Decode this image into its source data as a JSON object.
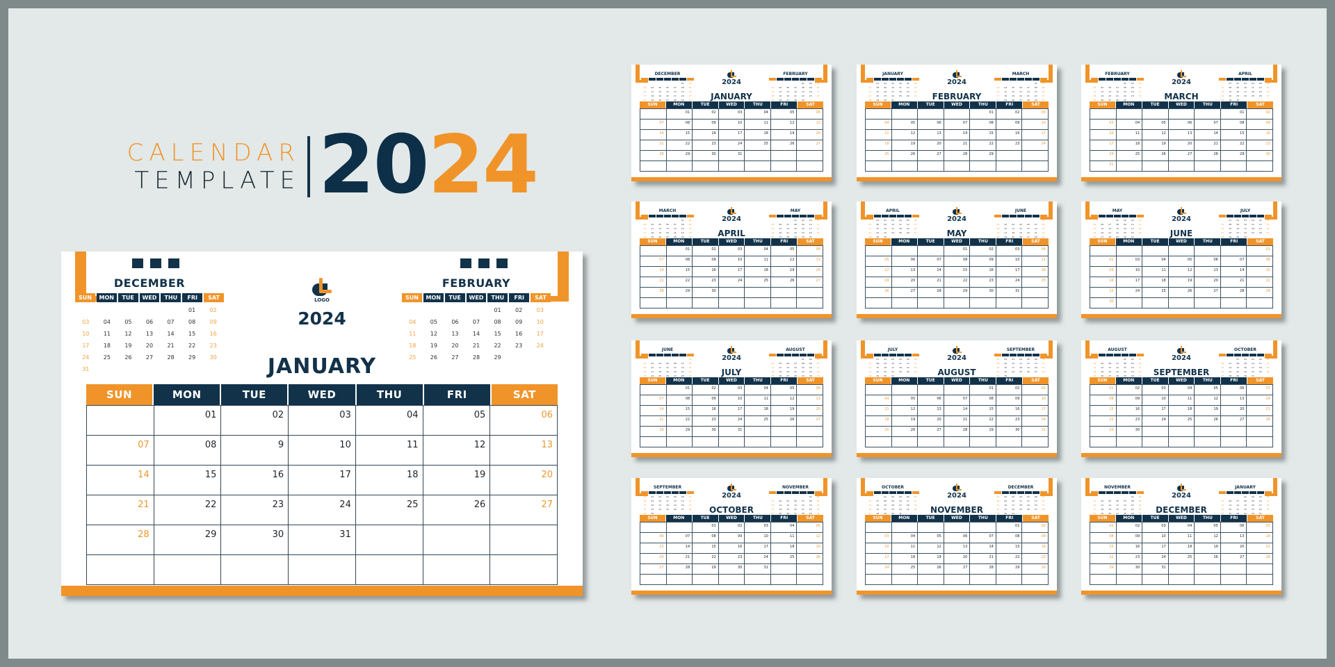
{
  "hero": {
    "line1": "CALENDAR",
    "line2": "TEMPLATE",
    "year_part1": "20",
    "year_part2": "24"
  },
  "colors": {
    "accent": "#f0942a",
    "navy": "#12324a",
    "background": "#e3e9e8",
    "frame": "#7f8a8a"
  },
  "weekdays": [
    "SUN",
    "MON",
    "TUE",
    "WED",
    "THU",
    "FRI",
    "SAT"
  ],
  "featured": {
    "month": "JANUARY",
    "year": "2024",
    "logo_text": "LOGO",
    "weeks": [
      [
        "",
        "01",
        "02",
        "03",
        "04",
        "05",
        "06"
      ],
      [
        "07",
        "08",
        "9",
        "10",
        "11",
        "12",
        "13"
      ],
      [
        "14",
        "15",
        "16",
        "17",
        "18",
        "19",
        "20"
      ],
      [
        "21",
        "22",
        "23",
        "24",
        "25",
        "26",
        "27"
      ],
      [
        "28",
        "29",
        "30",
        "31",
        "",
        "",
        ""
      ],
      [
        "",
        "",
        "",
        "",
        "",
        "",
        ""
      ]
    ],
    "prev_mini": {
      "title": "DECEMBER",
      "weeks": [
        [
          "",
          "",
          "",
          "",
          "",
          "01",
          "02"
        ],
        [
          "03",
          "04",
          "05",
          "06",
          "07",
          "08",
          "09"
        ],
        [
          "10",
          "11",
          "12",
          "13",
          "14",
          "15",
          "16"
        ],
        [
          "17",
          "18",
          "19",
          "20",
          "21",
          "22",
          "23"
        ],
        [
          "24",
          "25",
          "26",
          "27",
          "28",
          "29",
          "30"
        ],
        [
          "31",
          "",
          "",
          "",
          "",
          "",
          ""
        ]
      ]
    },
    "next_mini": {
      "title": "FEBRUARY",
      "weeks": [
        [
          "",
          "",
          "",
          "",
          "01",
          "02",
          "03"
        ],
        [
          "04",
          "05",
          "06",
          "07",
          "08",
          "09",
          "10"
        ],
        [
          "11",
          "12",
          "13",
          "14",
          "15",
          "16",
          "17"
        ],
        [
          "18",
          "19",
          "20",
          "21",
          "22",
          "23",
          "24"
        ],
        [
          "25",
          "26",
          "27",
          "28",
          "29",
          "",
          ""
        ]
      ]
    }
  },
  "thumbnails": [
    {
      "month": "JANUARY",
      "year": "2024",
      "start": 1,
      "days": 31,
      "prev": {
        "title": "DECEMBER",
        "start": 5,
        "days": 31
      },
      "next": {
        "title": "FEBRUARY",
        "start": 4,
        "days": 29
      }
    },
    {
      "month": "FEBRUARY",
      "year": "2024",
      "start": 4,
      "days": 29,
      "prev": {
        "title": "JANUARY",
        "start": 1,
        "days": 31
      },
      "next": {
        "title": "MARCH",
        "start": 5,
        "days": 31
      }
    },
    {
      "month": "MARCH",
      "year": "2024",
      "start": 5,
      "days": 31,
      "prev": {
        "title": "FEBRUARY",
        "start": 4,
        "days": 29
      },
      "next": {
        "title": "APRIL",
        "start": 1,
        "days": 30
      }
    },
    {
      "month": "APRIL",
      "year": "2024",
      "start": 1,
      "days": 30,
      "prev": {
        "title": "MARCH",
        "start": 5,
        "days": 31
      },
      "next": {
        "title": "MAY",
        "start": 3,
        "days": 31
      }
    },
    {
      "month": "MAY",
      "year": "2024",
      "start": 3,
      "days": 31,
      "prev": {
        "title": "APRIL",
        "start": 1,
        "days": 30
      },
      "next": {
        "title": "JUNE",
        "start": 6,
        "days": 30
      }
    },
    {
      "month": "JUNE",
      "year": "2024",
      "start": 6,
      "days": 30,
      "prev": {
        "title": "MAY",
        "start": 3,
        "days": 31
      },
      "next": {
        "title": "JULY",
        "start": 1,
        "days": 31
      }
    },
    {
      "month": "JULY",
      "year": "2024",
      "start": 1,
      "days": 31,
      "prev": {
        "title": "JUNE",
        "start": 6,
        "days": 30
      },
      "next": {
        "title": "AUGUST",
        "start": 4,
        "days": 31
      }
    },
    {
      "month": "AUGUST",
      "year": "2024",
      "start": 4,
      "days": 31,
      "prev": {
        "title": "JULY",
        "start": 1,
        "days": 31
      },
      "next": {
        "title": "SEPTEMBER",
        "start": 0,
        "days": 30
      }
    },
    {
      "month": "SEPTEMBER",
      "year": "2024",
      "start": 0,
      "days": 30,
      "prev": {
        "title": "AUGUST",
        "start": 4,
        "days": 31
      },
      "next": {
        "title": "OCTOBER",
        "start": 2,
        "days": 31
      }
    },
    {
      "month": "OCTOBER",
      "year": "2024",
      "start": 2,
      "days": 31,
      "prev": {
        "title": "SEPTEMBER",
        "start": 0,
        "days": 30
      },
      "next": {
        "title": "NOVEMBER",
        "start": 5,
        "days": 30
      }
    },
    {
      "month": "NOVEMBER",
      "year": "2024",
      "start": 5,
      "days": 30,
      "prev": {
        "title": "OCTOBER",
        "start": 2,
        "days": 31
      },
      "next": {
        "title": "DECEMBER",
        "start": 0,
        "days": 31
      }
    },
    {
      "month": "DECEMBER",
      "year": "2024",
      "start": 0,
      "days": 31,
      "prev": {
        "title": "NOVEMBER",
        "start": 5,
        "days": 30
      },
      "next": {
        "title": "JANUARY",
        "start": 3,
        "days": 31
      }
    }
  ]
}
